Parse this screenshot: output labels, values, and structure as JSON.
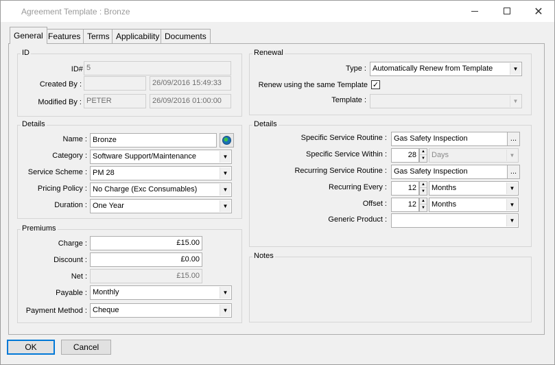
{
  "window": {
    "title": "Agreement Template : Bronze"
  },
  "tabs": [
    "General",
    "Features",
    "Terms",
    "Applicability",
    "Documents"
  ],
  "id_group": {
    "title": "ID",
    "id_label": "ID# :",
    "id_value": "5",
    "created_label": "Created By :",
    "created_by": "",
    "created_at": "26/09/2016 15:49:33",
    "modified_label": "Modified By :",
    "modified_by": "PETER",
    "modified_at": "26/09/2016 01:00:00"
  },
  "details_left": {
    "title": "Details",
    "name_label": "Name :",
    "name": "Bronze",
    "category_label": "Category :",
    "category": "Software Support/Maintenance",
    "scheme_label": "Service Scheme :",
    "scheme": "PM 28",
    "pricing_label": "Pricing Policy :",
    "pricing": "No Charge (Exc Consumables)",
    "duration_label": "Duration :",
    "duration": "One Year"
  },
  "premiums": {
    "title": "Premiums",
    "charge_label": "Charge :",
    "charge": "£15.00",
    "discount_label": "Discount :",
    "discount": "£0.00",
    "net_label": "Net :",
    "net": "£15.00",
    "payable_label": "Payable :",
    "payable": "Monthly",
    "method_label": "Payment Method :",
    "method": "Cheque"
  },
  "renewal": {
    "title": "Renewal",
    "type_label": "Type :",
    "type": "Automatically Renew from Template",
    "same_template_label": "Renew using the same Template",
    "same_template_checked": true,
    "check_glyph": "✓",
    "template_label": "Template :",
    "template": ""
  },
  "details_right": {
    "title": "Details",
    "routine_label": "Specific Service Routine :",
    "routine": "Gas Safety Inspection",
    "within_label": "Specific Service Within :",
    "within_value": "28",
    "within_unit": "Days",
    "recurring_routine_label": "Recurring Service Routine :",
    "recurring_routine": "Gas Safety Inspection",
    "every_label": "Recurring Every :",
    "every_value": "12",
    "every_unit": "Months",
    "offset_label": "Offset :",
    "offset_value": "12",
    "offset_unit": "Months",
    "generic_label": "Generic Product :",
    "generic": "",
    "ellipsis": "..."
  },
  "notes": {
    "title": "Notes",
    "text": ""
  },
  "buttons": {
    "ok": "OK",
    "cancel": "Cancel"
  }
}
